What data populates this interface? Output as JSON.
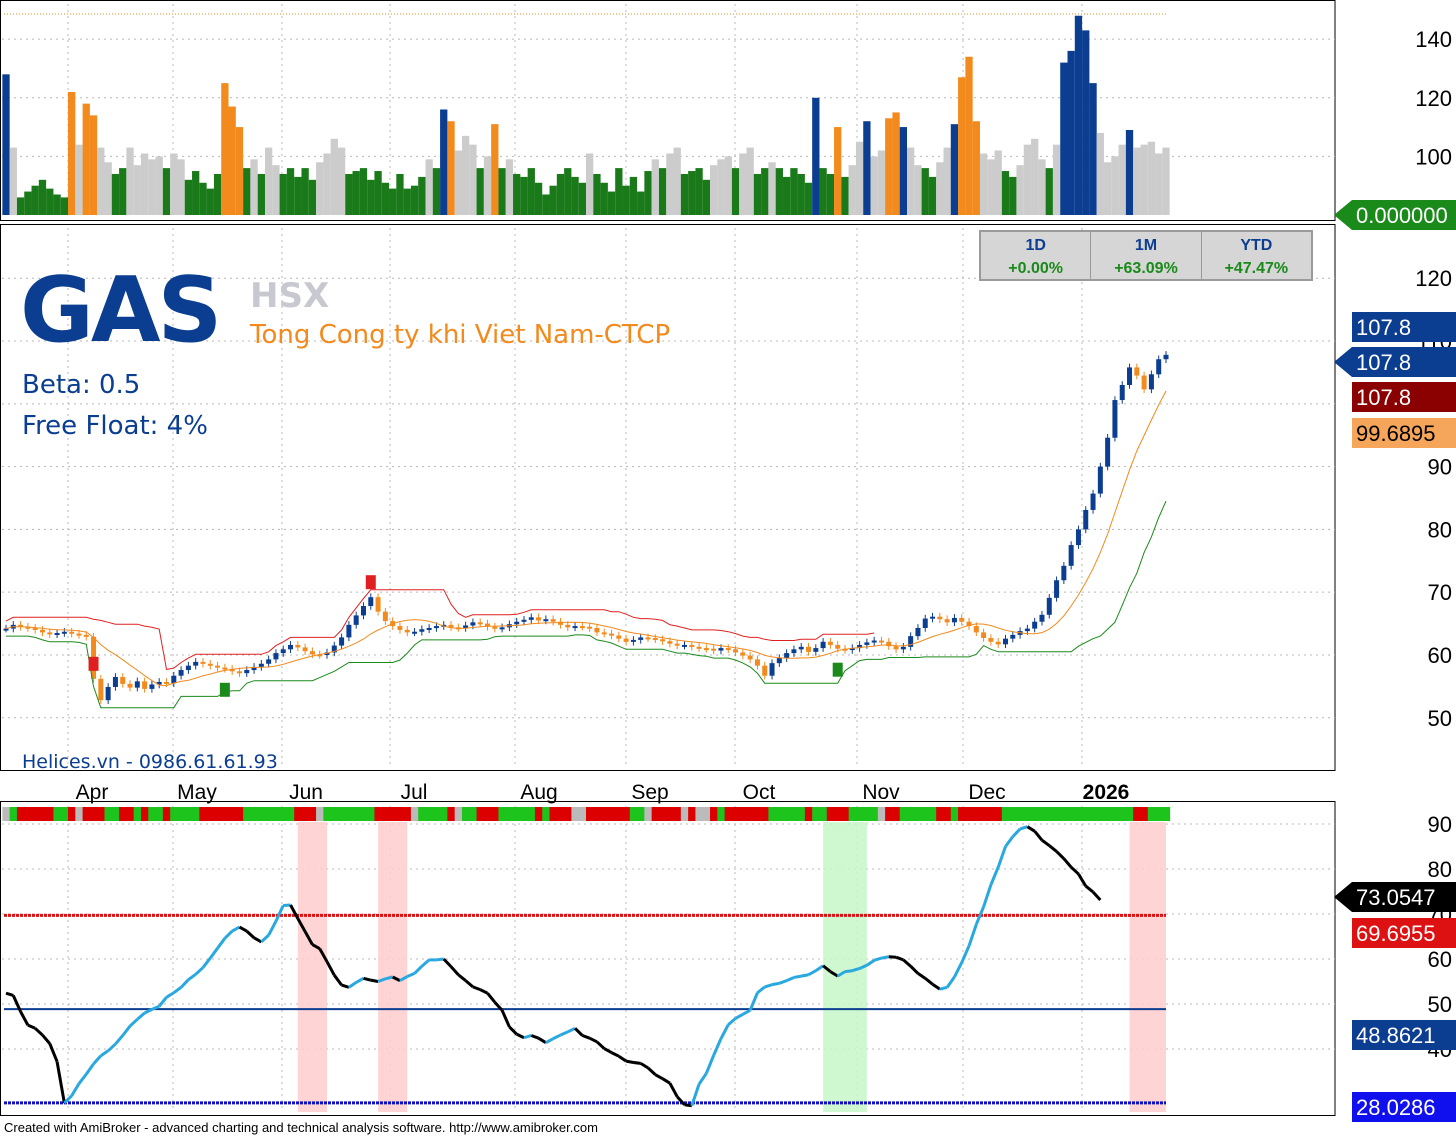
{
  "header": {
    "ticker": "GAS",
    "exchange": "HSX",
    "company": "Tong Cong ty khi Viet Nam-CTCP",
    "beta": "Beta: 0.5",
    "free_float": "Free Float: 4%",
    "watermark": "Helices.vn - 0986.61.61.93"
  },
  "performance": [
    {
      "label": "1D",
      "value": "+0.00%"
    },
    {
      "label": "1M",
      "value": "+63.09%"
    },
    {
      "label": "YTD",
      "value": "+47.47%"
    }
  ],
  "footer": "Created with AmiBroker - advanced charting and technical analysis software. http://www.amibroker.com",
  "colors": {
    "up_candle": "#0b3d91",
    "down_candle": "#f28a1e",
    "volume_gray": "#cccccc",
    "volume_green": "#1a7a1a",
    "sma_orange": "#f28a1e",
    "stop_red": "#e02020",
    "stop_green": "#1a8a1a",
    "rsi_up": "#29a8e0",
    "rsi_down": "#000000"
  },
  "chart_data": [
    {
      "panel": "volume",
      "type": "bar",
      "ylim": [
        80,
        152
      ],
      "yticks": [
        "100",
        "120",
        "140"
      ],
      "last_value_label": "0.000000",
      "values": [
        128,
        103,
        86,
        88,
        90,
        92,
        89,
        87,
        86,
        122,
        104,
        118,
        114,
        103,
        98,
        94,
        96,
        103,
        97,
        101,
        99,
        100,
        96,
        101,
        99,
        92,
        95,
        91,
        89,
        94,
        125,
        117,
        110,
        96,
        99,
        94,
        103,
        97,
        94,
        96,
        93,
        96,
        92,
        98,
        101,
        106,
        103,
        94,
        95,
        96,
        92,
        95,
        91,
        89,
        94,
        89,
        90,
        93,
        99,
        96,
        116,
        112,
        102,
        107,
        104,
        96,
        100,
        111,
        96,
        99,
        94,
        93,
        96,
        91,
        87,
        90,
        94,
        96,
        93,
        91,
        101,
        94,
        91,
        88,
        96,
        90,
        93,
        88,
        95,
        99,
        96,
        101,
        103,
        94,
        95,
        96,
        92,
        97,
        99,
        100,
        96,
        101,
        103,
        94,
        96,
        98,
        96,
        93,
        96,
        94,
        91,
        120,
        96,
        94,
        110,
        93,
        97,
        105,
        112,
        100,
        102,
        113,
        115,
        110,
        103,
        97,
        96,
        93,
        98,
        103,
        111,
        127,
        134,
        112,
        101,
        99,
        102,
        95,
        93,
        97,
        104,
        106,
        99,
        96,
        104,
        132,
        136,
        148,
        143,
        125,
        108,
        98,
        100,
        104,
        109,
        103,
        104,
        105,
        101,
        103
      ]
    },
    {
      "panel": "price",
      "type": "candlestick",
      "ylim": [
        42,
        128
      ],
      "yticks": [
        "50",
        "60",
        "70",
        "80",
        "90",
        "100",
        "110",
        "120"
      ],
      "x": [
        "Apr",
        "May",
        "Jun",
        "Jul",
        "Aug",
        "Sep",
        "Oct",
        "Nov",
        "Dec",
        "2026"
      ],
      "close": [
        64.2,
        64.8,
        64.5,
        64.3,
        64.0,
        63.6,
        63.3,
        63.5,
        63.7,
        63.4,
        63.2,
        62.9,
        56.2,
        52.8,
        54.9,
        56.5,
        55.4,
        54.8,
        55.8,
        54.6,
        55.3,
        55.7,
        55.5,
        56.7,
        57.6,
        58.3,
        58.9,
        58.6,
        58.3,
        58.0,
        57.8,
        57.4,
        57.1,
        57.6,
        58.1,
        58.6,
        59.3,
        60.3,
        60.9,
        61.6,
        61.2,
        60.6,
        60.1,
        60.0,
        60.4,
        61.5,
        62.8,
        64.8,
        66.3,
        67.8,
        69.2,
        66.9,
        65.4,
        64.6,
        64.0,
        63.6,
        63.7,
        64.1,
        64.3,
        64.6,
        64.8,
        64.4,
        64.3,
        64.7,
        65.2,
        65.0,
        64.5,
        64.2,
        64.4,
        64.9,
        65.3,
        65.6,
        66.0,
        65.5,
        65.7,
        65.3,
        64.8,
        64.4,
        64.6,
        64.5,
        64.3,
        63.6,
        63.4,
        63.1,
        62.6,
        62.1,
        62.4,
        62.8,
        62.7,
        62.5,
        62.2,
        61.8,
        61.5,
        61.6,
        61.3,
        61.1,
        61.0,
        60.7,
        61.1,
        60.9,
        60.4,
        59.9,
        59.3,
        58.3,
        56.7,
        58.7,
        59.5,
        60.3,
        60.9,
        61.3,
        60.5,
        61.1,
        62.1,
        61.6,
        61.0,
        60.8,
        61.1,
        61.6,
        62.0,
        62.3,
        62.1,
        61.4,
        60.9,
        61.3,
        63.0,
        64.3,
        65.8,
        66.1,
        65.7,
        65.2,
        65.9,
        65.3,
        64.6,
        63.6,
        62.7,
        62.1,
        61.7,
        62.6,
        63.2,
        63.8,
        64.2,
        65.3,
        66.4,
        69.1,
        71.9,
        74.2,
        77.5,
        80.0,
        83.1,
        85.7,
        90.0,
        94.6,
        100.6,
        103.0,
        105.8,
        104.5,
        102.3,
        104.7,
        107.1,
        107.8
      ]
    },
    {
      "panel": "oscillator",
      "type": "line",
      "ylim": [
        26,
        94
      ],
      "yticks": [
        "40",
        "50",
        "60",
        "70",
        "80",
        "90"
      ],
      "reference_lines": [
        69.6955,
        48.8621,
        28.0286
      ],
      "value_labels": [
        "73.0547",
        "69.6955",
        "48.8621",
        "28.0286"
      ],
      "values": [
        52.4,
        51.9,
        48.3,
        45.3,
        44.6,
        43.1,
        41.2,
        37.2,
        28.0,
        29.6,
        32.3,
        34.4,
        36.7,
        38.5,
        39.6,
        41.1,
        43.0,
        45.1,
        46.6,
        48.0,
        48.8,
        49.5,
        51.5,
        52.5,
        53.7,
        55.4,
        56.6,
        58.1,
        60.2,
        62.4,
        64.6,
        66.2,
        67.1,
        66.2,
        64.7,
        63.8,
        65.3,
        68.4,
        71.9,
        72.0,
        69.0,
        66.1,
        63.2,
        62.3,
        59.4,
        56.4,
        54.2,
        53.7,
        54.8,
        55.7,
        55.3,
        55.0,
        55.6,
        56.0,
        55.2,
        56.1,
        56.8,
        58.4,
        59.8,
        59.8,
        60.0,
        58.3,
        56.5,
        55.2,
        53.8,
        53.2,
        52.4,
        50.4,
        48.6,
        44.9,
        43.3,
        42.5,
        43.0,
        42.4,
        41.4,
        42.3,
        43.1,
        43.8,
        44.6,
        43.0,
        42.4,
        41.6,
        40.1,
        39.2,
        38.4,
        37.3,
        37.0,
        36.8,
        35.8,
        34.3,
        33.4,
        32.4,
        29.4,
        27.6,
        27.4,
        32.2,
        34.6,
        38.6,
        42.3,
        45.4,
        46.8,
        47.7,
        48.6,
        52.5,
        53.8,
        54.3,
        54.6,
        55.2,
        55.9,
        56.2,
        56.5,
        57.4,
        58.5,
        57.2,
        56.2,
        57.2,
        57.4,
        57.9,
        58.6,
        59.7,
        60.2,
        60.5,
        60.4,
        59.8,
        58.4,
        56.8,
        55.7,
        54.4,
        53.3,
        53.7,
        56.0,
        59.2,
        62.9,
        67.7,
        71.6,
        76.5,
        80.4,
        85.0,
        87.2,
        88.9,
        89.4,
        88.4,
        86.4,
        85.2,
        83.9,
        82.3,
        80.4,
        78.9,
        76.2,
        74.9,
        73.1
      ]
    }
  ]
}
